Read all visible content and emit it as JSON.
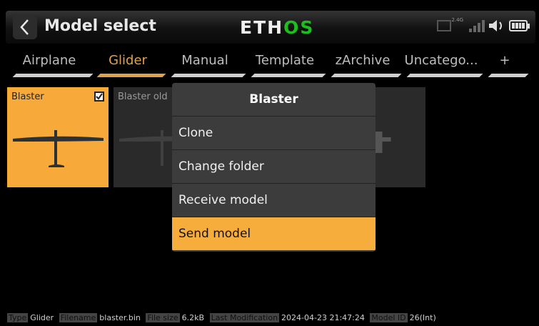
{
  "header": {
    "title": "Model select",
    "brand_part1": "ETH",
    "brand_part2": "OS",
    "rf_label": "2.4G"
  },
  "tabs": [
    {
      "label": "Airplane"
    },
    {
      "label": "Glider"
    },
    {
      "label": "Manual"
    },
    {
      "label": "Template"
    },
    {
      "label": "zArchive"
    },
    {
      "label": "Uncatego..."
    },
    {
      "label": "+"
    }
  ],
  "active_tab": "Glider",
  "models": [
    {
      "name": "Blaster",
      "selected": true
    },
    {
      "name": "Blaster old",
      "selected": false
    }
  ],
  "menu": {
    "title": "Blaster",
    "items": [
      {
        "label": "Clone"
      },
      {
        "label": "Change folder"
      },
      {
        "label": "Receive model"
      },
      {
        "label": "Send model"
      }
    ],
    "selected_item": "Send model"
  },
  "footer": {
    "type_label": "Type",
    "type_value": "Glider",
    "filename_label": "Filename",
    "filename_value": "blaster.bin",
    "filesize_label": "File size",
    "filesize_value": "6.2kB",
    "lastmod_label": "Last Modification",
    "lastmod_value": "2024-04-23 21:47:24",
    "modelid_label": "Model ID",
    "modelid_value": "26(Int)"
  },
  "colors": {
    "accent": "#f7ad3c",
    "brand_green": "#1cc01c"
  }
}
